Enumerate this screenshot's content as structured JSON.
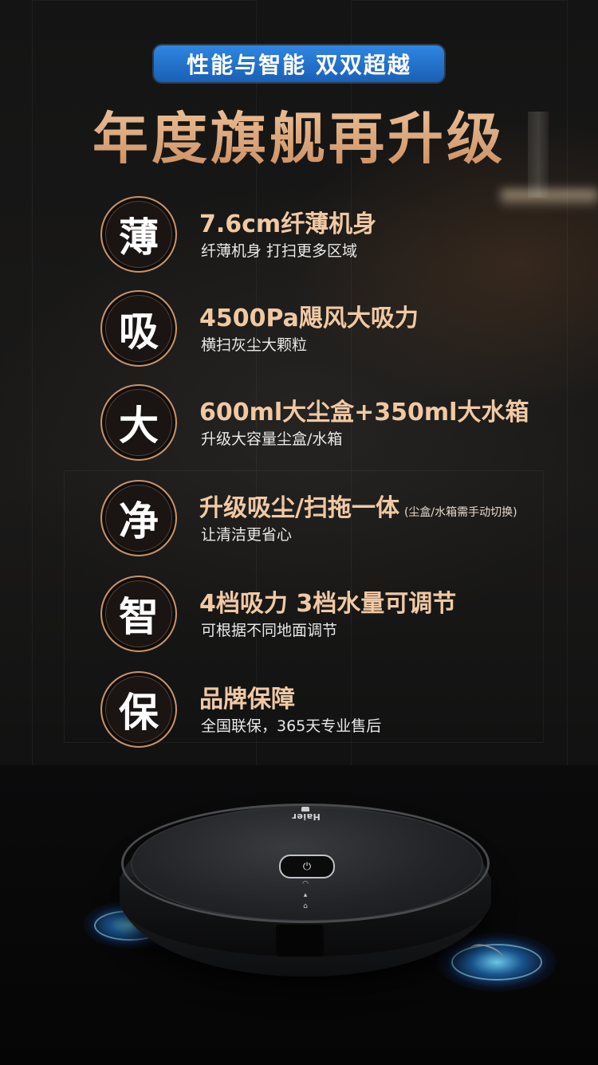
{
  "banner": {
    "text": "性能与智能 双双超越",
    "color": "#1f6cc4"
  },
  "headline": {
    "text": "年度旗舰再升级",
    "color": "#d9a57a"
  },
  "features": [
    {
      "badge": "薄",
      "title": "7.6cm纤薄机身",
      "note": "",
      "subtitle": "纤薄机身 打扫更多区域"
    },
    {
      "badge": "吸",
      "title": "4500Pa飓风大吸力",
      "note": "",
      "subtitle": "横扫灰尘大颗粒"
    },
    {
      "badge": "大",
      "title": "600ml大尘盒+350ml大水箱",
      "note": "",
      "subtitle": "升级大容量尘盒/水箱"
    },
    {
      "badge": "净",
      "title": "升级吸尘/扫拖一体",
      "note": "(尘盒/水箱需手动切换)",
      "subtitle": "让清洁更省心"
    },
    {
      "badge": "智",
      "title": "4档吸力 3档水量可调节",
      "note": "",
      "subtitle": "可根据不同地面调节"
    },
    {
      "badge": "保",
      "title": "品牌保障",
      "note": "",
      "subtitle": "全国联保，365天专业售后"
    }
  ],
  "product": {
    "brand_logo": "Haier",
    "power_icon": "power-icon",
    "control_icons": [
      "wifi-icon",
      "mode-icon",
      "home-return-icon"
    ],
    "glow_color": "#3aa8ff"
  }
}
